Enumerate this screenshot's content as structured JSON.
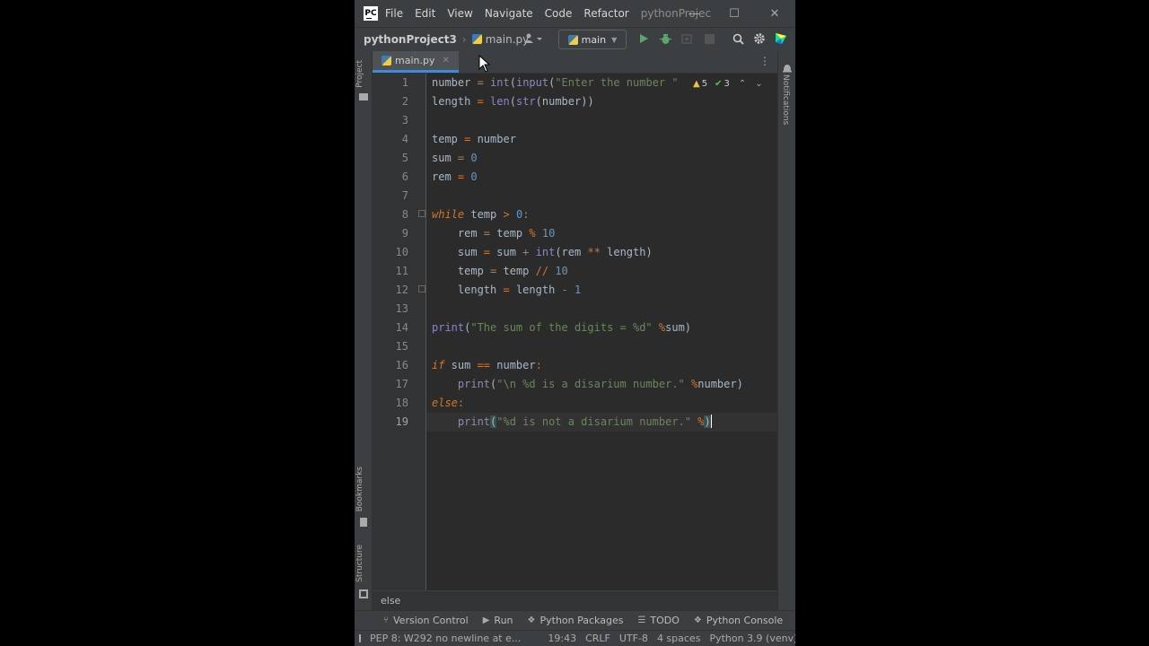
{
  "menu": {
    "items": [
      "File",
      "Edit",
      "View",
      "Navigate",
      "Code",
      "Refactor"
    ],
    "project_title": "pythonProjec"
  },
  "logo_text": "PC",
  "window_controls": {
    "minimize": "—",
    "maximize": "☐",
    "close": "✕"
  },
  "navbar": {
    "project": "pythonProject3",
    "file": "main.py",
    "branch": "main"
  },
  "left_tabs": [
    "Project",
    "Bookmarks",
    "Structure"
  ],
  "right_tabs": [
    "Notifications"
  ],
  "editor_tab": {
    "label": "main.py",
    "close": "✕"
  },
  "inspections": {
    "warnings": "5",
    "weak_warnings": "3"
  },
  "code": {
    "line_numbers": [
      "1",
      "2",
      "3",
      "4",
      "5",
      "6",
      "7",
      "8",
      "9",
      "10",
      "11",
      "12",
      "13",
      "14",
      "15",
      "16",
      "17",
      "18",
      "19"
    ],
    "current_line": 19
  },
  "breadcrumb": "else",
  "tool_windows": [
    "Version Control",
    "Run",
    "Python Packages",
    "TODO",
    "Python Console"
  ],
  "status": {
    "message": "PEP 8: W292 no newline at e...",
    "position": "19:43",
    "line_sep": "CRLF",
    "encoding": "UTF-8",
    "indent": "4 spaces",
    "interpreter": "Python 3.9 (venv)"
  },
  "colors": {
    "background": "#2b2b2b",
    "keyword": "#cc7832",
    "string": "#6a8759",
    "number": "#6897bb",
    "builtin": "#8888c6",
    "run_green": "#59a869",
    "accent_blue": "#4a88c7"
  }
}
